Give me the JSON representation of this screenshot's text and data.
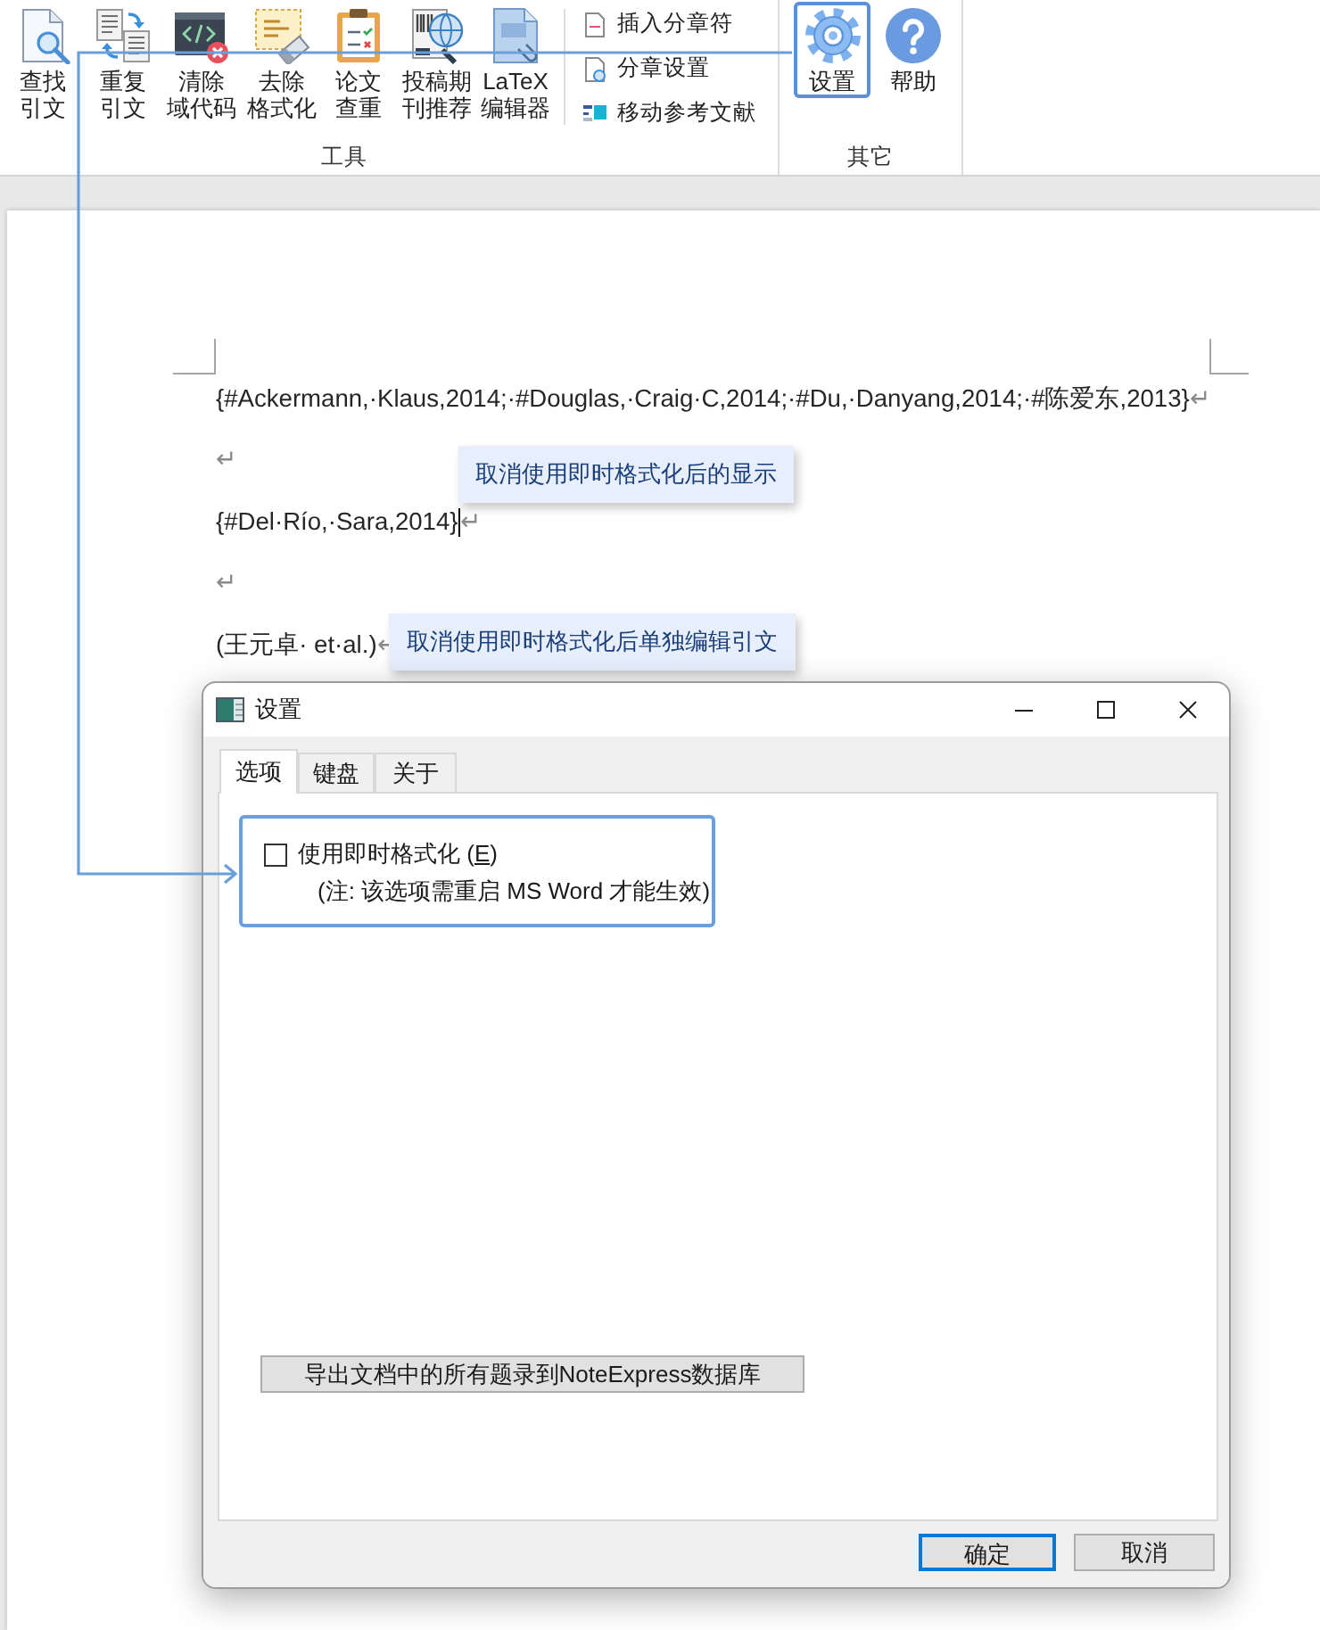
{
  "ribbon": {
    "groups": [
      {
        "label": "工具",
        "large_buttons": [
          {
            "label_lines": [
              "查找",
              "引文"
            ],
            "highlighted": false
          },
          {
            "label_lines": [
              "重复",
              "引文"
            ],
            "highlighted": false
          },
          {
            "label_lines": [
              "清除",
              "域代码"
            ],
            "highlighted": false
          },
          {
            "label_lines": [
              "去除",
              "格式化"
            ],
            "highlighted": false
          },
          {
            "label_lines": [
              "论文",
              "查重"
            ],
            "highlighted": false
          },
          {
            "label_lines": [
              "投稿期",
              "刊推荐"
            ],
            "highlighted": false
          },
          {
            "label_lines": [
              "LaTeX",
              "编辑器"
            ],
            "highlighted": false
          }
        ],
        "small_buttons": [
          {
            "label": "插入分章符"
          },
          {
            "label": "分章设置"
          },
          {
            "label": "移动参考文献"
          }
        ]
      },
      {
        "label": "其它",
        "large_buttons": [
          {
            "label_lines": [
              "设置"
            ],
            "highlighted": true
          },
          {
            "label_lines": [
              "帮助"
            ],
            "highlighted": false
          }
        ]
      }
    ]
  },
  "document": {
    "paragraphs": [
      {
        "text": "{#Ackermann,·Klaus,2014;·#Douglas,·Craig·C,2014;·#Du,·Danyang,2014;·#陈爱东,2013}",
        "mark": "↵",
        "cursor": false
      },
      {
        "mark": "↵",
        "cursor": false
      },
      {
        "text": "{#Del·Río,·Sara,2014}",
        "mark": "↵",
        "cursor": true
      },
      {
        "mark": "↵",
        "cursor": false
      },
      {
        "text": "(王元卓· et·al.)",
        "mark": "↵",
        "cursor": false
      }
    ]
  },
  "annotations": [
    {
      "text": "取消使用即时格式化后的显示"
    },
    {
      "text": "取消使用即时格式化后单独编辑引文"
    }
  ],
  "dialog": {
    "title": "设置",
    "tabs": [
      {
        "label": "选项",
        "selected": true
      },
      {
        "label": "键盘",
        "selected": false
      },
      {
        "label": "关于",
        "selected": false
      }
    ],
    "option_group": {
      "highlighted": true,
      "checkbox": {
        "label_before": "使用即时格式化 (",
        "access_key": "E",
        "label_after": ")",
        "checked": false
      },
      "note": "(注: 该选项需重启 MS Word 才能生效)"
    },
    "export_button": "导出文档中的所有题录到NoteExpress数据库",
    "buttons": [
      {
        "label": "确定",
        "default": true
      },
      {
        "label": "取消",
        "default": false
      }
    ]
  }
}
